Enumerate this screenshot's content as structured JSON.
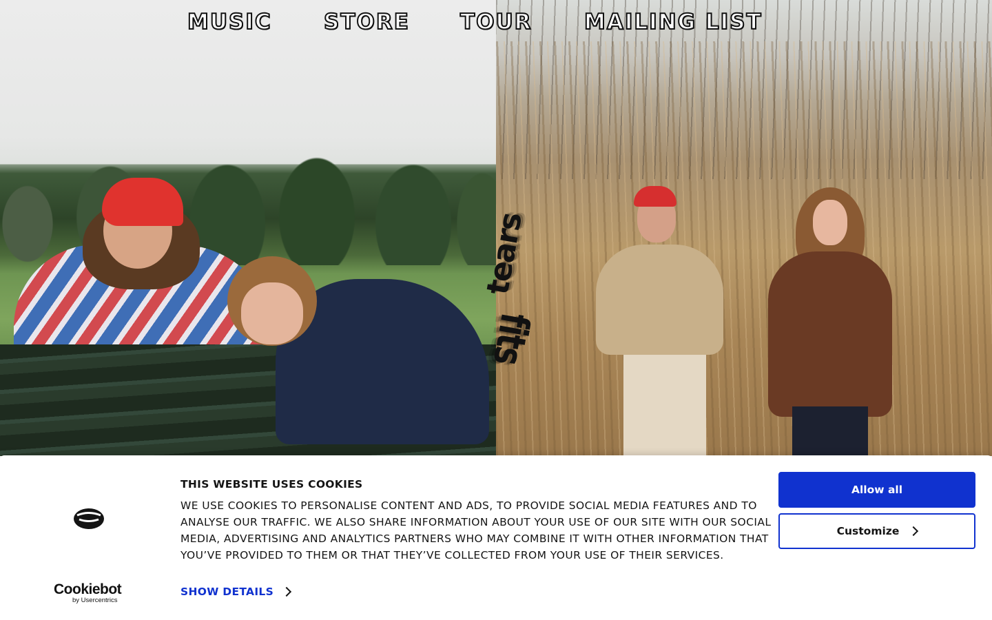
{
  "nav": {
    "items": [
      {
        "label": "MUSIC"
      },
      {
        "label": "STORE"
      },
      {
        "label": "TOUR"
      },
      {
        "label": "MAILING LIST"
      }
    ]
  },
  "hero": {
    "logo_words": [
      "tears",
      "fits"
    ]
  },
  "cookie_banner": {
    "title": "THIS WEBSITE USES COOKIES",
    "text": "WE USE COOKIES TO PERSONALISE CONTENT AND ADS, TO PROVIDE SOCIAL MEDIA FEATURES AND TO ANALYSE OUR TRAFFIC. WE ALSO SHARE INFORMATION ABOUT YOUR USE OF OUR SITE WITH OUR SOCIAL MEDIA, ADVERTISING AND ANALYTICS PARTNERS WHO MAY COMBINE IT WITH OTHER INFORMATION THAT YOU’VE PROVIDED TO THEM OR THAT THEY’VE COLLECTED FROM YOUR USE OF THEIR SERVICES.",
    "show_details": "SHOW DETAILS",
    "allow_all": "Allow all",
    "customize": "Customize",
    "brand_name": "Cookiebot",
    "brand_by": "by Usercentrics",
    "accent_color": "#1032cf"
  }
}
